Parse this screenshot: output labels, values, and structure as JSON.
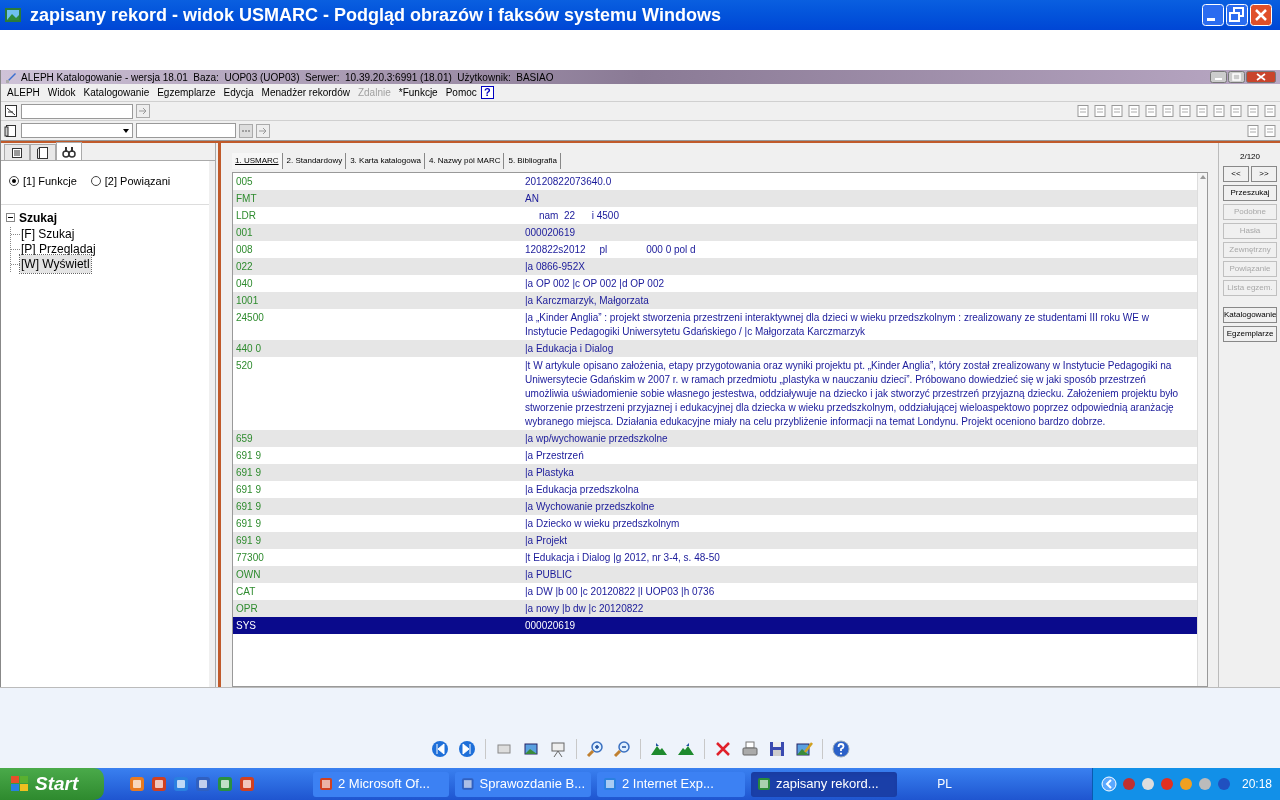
{
  "viewer": {
    "title": "zapisany rekord - widok USMARC - Podgląd obrazów i faksów systemu Windows"
  },
  "app": {
    "title": "ALEPH Katalogowanie - wersja 18.01  Baza:  UOP03 (UOP03)  Serwer:  10.39.20.3:6991 (18.01)  Użytkownik:  BASIAO",
    "menu": [
      {
        "label": "ALEPH",
        "disabled": false
      },
      {
        "label": "Widok",
        "disabled": false
      },
      {
        "label": "Katalogowanie",
        "disabled": false
      },
      {
        "label": "Egzemplarze",
        "disabled": false
      },
      {
        "label": "Edycja",
        "disabled": false
      },
      {
        "label": "Menadżer rekordów",
        "disabled": false
      },
      {
        "label": "Zdalnie",
        "disabled": true
      },
      {
        "label": "*Funkcje",
        "disabled": false
      },
      {
        "label": "Pomoc",
        "disabled": false
      }
    ],
    "help_button": "?",
    "left_panel": {
      "tabs": [
        {
          "kind": "list",
          "selected": false
        },
        {
          "kind": "page",
          "selected": false
        },
        {
          "kind": "binoculars",
          "selected": true
        }
      ],
      "radios": [
        {
          "label": "[1] Funkcje",
          "selected": true
        },
        {
          "label": "[2] Powiązani",
          "selected": false
        }
      ],
      "tree": {
        "label": "Szukaj",
        "expanded": true,
        "children": [
          {
            "label": "[F] Szukaj",
            "selected": false
          },
          {
            "label": "[P] Przeglądaj",
            "selected": false
          },
          {
            "label": "[W] Wyświetl",
            "selected": true
          }
        ]
      }
    },
    "record_tabs": [
      {
        "label": "1. USMARC",
        "selected": true
      },
      {
        "label": "2. Standardowy",
        "selected": false
      },
      {
        "label": "3. Karta katalogowa",
        "selected": false
      },
      {
        "label": "4. Nazwy pól MARC",
        "selected": false
      },
      {
        "label": "5. Bibliografia",
        "selected": false
      }
    ],
    "fields": [
      {
        "tag": "005",
        "value": "20120822073640.0",
        "selected": false
      },
      {
        "tag": "FMT",
        "value": "AN",
        "selected": false
      },
      {
        "tag": "LDR",
        "value": "     nam  22      i 4500",
        "selected": false
      },
      {
        "tag": "001",
        "value": "000020619",
        "selected": false
      },
      {
        "tag": "008",
        "value": "120822s2012     pl              000 0 pol d",
        "selected": false
      },
      {
        "tag": "022",
        "value": "|a 0866-952X",
        "selected": false
      },
      {
        "tag": "040",
        "value": "|a OP 002 |c OP 002 |d OP 002",
        "selected": false
      },
      {
        "tag": "1001",
        "value": "|a Karczmarzyk, Małgorzata",
        "selected": false
      },
      {
        "tag": "24500",
        "value": "|a „Kinder Anglia” : projekt stworzenia przestrzeni interaktywnej dla dzieci w wieku przedszkolnym : zrealizowany ze studentami III roku WE w Instytucie Pedagogiki Uniwersytetu Gdańskiego / |c Małgorzata Karczmarzyk",
        "selected": false
      },
      {
        "tag": "440 0",
        "value": "|a Edukacja i Dialog",
        "selected": false
      },
      {
        "tag": "520",
        "value": "|t W artykule opisano założenia, etapy przygotowania oraz wyniki projektu pt. „Kinder Anglia”, który został zrealizowany w Instytucie Pedagogiki na Uniwersytecie Gdańskim w 2007 r. w ramach przedmiotu „plastyka w nauczaniu dzieci”. Próbowano dowiedzieć się w jaki sposób przestrzeń umożliwia uświadomienie sobie własnego jestestwa, oddziaływuje na dziecko i jak stworzyć przestrzeń przyjazną dziecku. Założeniem projektu było stworzenie przestrzeni przyjaznej i edukacyjnej dla dziecka w wieku przedszkolnym, oddziałującej wieloaspektowo poprzez odpowiednią aranżację wybranego miejsca. Działania edukacyjne miały na celu przybliżenie informacji na temat Londynu. Projekt oceniono bardzo dobrze.",
        "selected": false
      },
      {
        "tag": "659",
        "value": "|a wp/wychowanie przedszkolne",
        "selected": false
      },
      {
        "tag": "691 9",
        "value": "|a Przestrzeń",
        "selected": false
      },
      {
        "tag": "691 9",
        "value": "|a Plastyka",
        "selected": false
      },
      {
        "tag": "691 9",
        "value": "|a Edukacja przedszkolna",
        "selected": false
      },
      {
        "tag": "691 9",
        "value": "|a Wychowanie przedszkolne",
        "selected": false
      },
      {
        "tag": "691 9",
        "value": "|a Dziecko w wieku przedszkolnym",
        "selected": false
      },
      {
        "tag": "691 9",
        "value": "|a Projekt",
        "selected": false
      },
      {
        "tag": "77300",
        "value": "|t Edukacja i Dialog |g 2012, nr 3-4, s. 48-50",
        "selected": false
      },
      {
        "tag": "OWN",
        "value": "|a PUBLIC",
        "selected": false
      },
      {
        "tag": "CAT",
        "value": "|a DW |b 00 |c 20120822 |l UOP03 |h 0736",
        "selected": false
      },
      {
        "tag": "OPR",
        "value": "|a nowy |b dw |c 20120822",
        "selected": false
      },
      {
        "tag": "SYS",
        "value": "000020619",
        "selected": true
      }
    ],
    "counter": "2/120",
    "nav_buttons": [
      "<<",
      ">>"
    ],
    "side_buttons": [
      {
        "label": "Przeszukaj",
        "disabled": false
      },
      {
        "label": "Podobne",
        "disabled": true
      },
      {
        "label": "Hasła",
        "disabled": true
      },
      {
        "label": "Zewnętrzny",
        "disabled": true
      },
      {
        "label": "Powiązanie",
        "disabled": true
      },
      {
        "label": "Lista egzem.",
        "disabled": true
      },
      {
        "label": "Katalogowanie",
        "disabled": false
      },
      {
        "label": "Egzemplarze",
        "disabled": false
      }
    ]
  },
  "taskbar": {
    "start": "Start",
    "tasks": [
      {
        "label": "2 Microsoft Of...",
        "selected": false
      },
      {
        "label": "Sprawozdanie B...",
        "selected": false
      },
      {
        "label": "2 Internet Exp...",
        "selected": false
      },
      {
        "label": "zapisany rekord...",
        "selected": true
      }
    ],
    "language": "PL",
    "time": "20:18"
  }
}
